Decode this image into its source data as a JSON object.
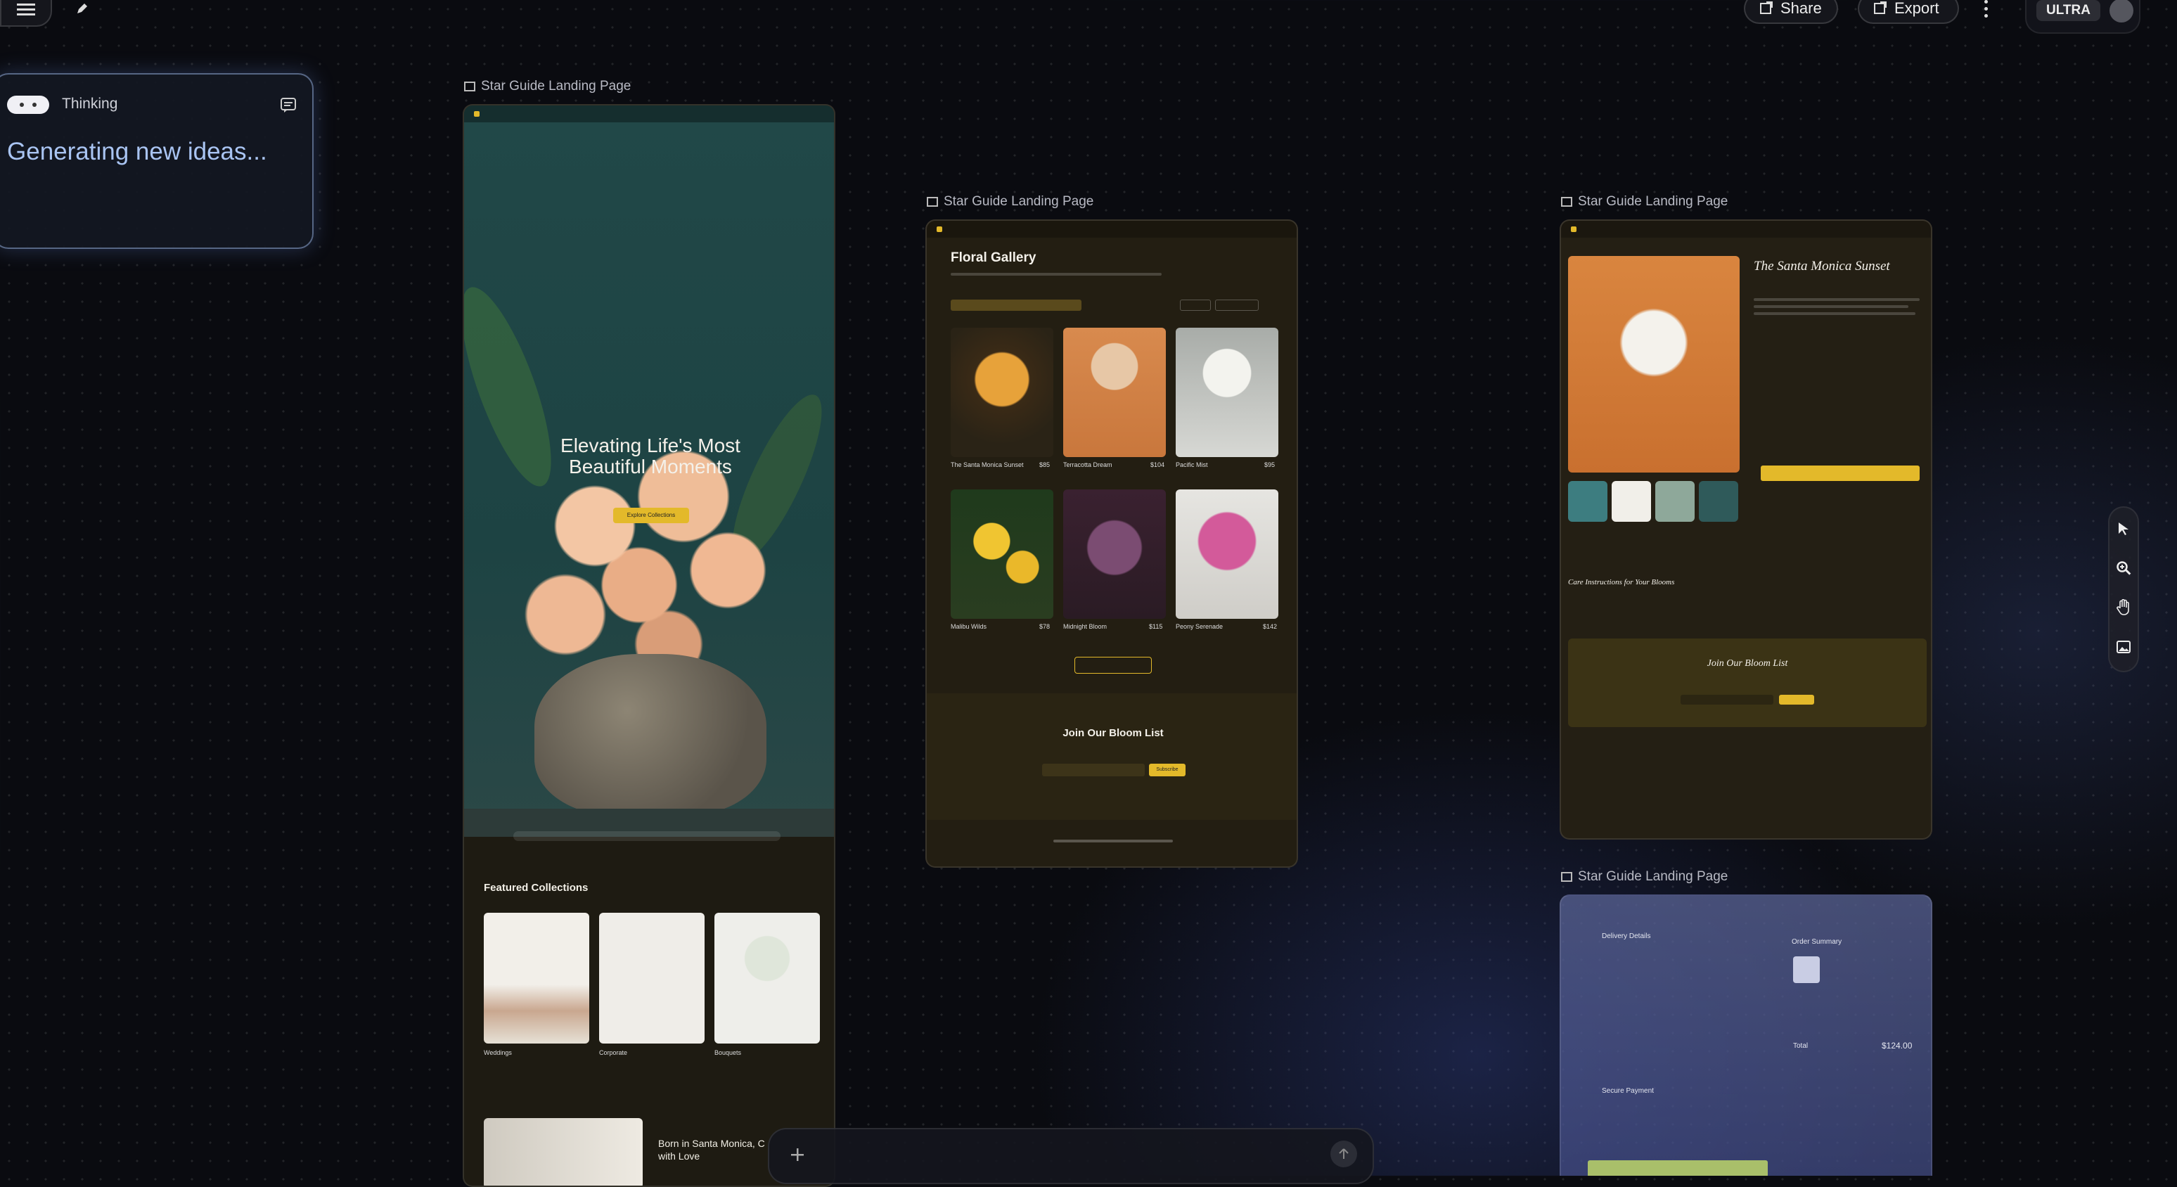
{
  "toolbar": {
    "share_label": "Share",
    "export_label": "Export",
    "plan_badge": "ULTRA"
  },
  "thinking": {
    "status": "Thinking",
    "message": "Generating new ideas..."
  },
  "frames": {
    "title": "Star Guide Landing Page"
  },
  "frame1": {
    "hero_title_line1": "Elevating Life's Most",
    "hero_title_line2": "Beautiful Moments",
    "cta": "Explore Collections",
    "section_title": "Featured Collections",
    "collections": [
      "Weddings",
      "Corporate",
      "Bouquets"
    ],
    "story_title_line1": "Born in Santa Monica, C",
    "story_title_line2": "with Love"
  },
  "frame2": {
    "gallery_title": "Floral Gallery",
    "products": [
      {
        "name": "The Santa Monica Sunset",
        "price": "$85"
      },
      {
        "name": "Terracotta Dream",
        "price": "$104"
      },
      {
        "name": "Pacific Mist",
        "price": "$95"
      },
      {
        "name": "Malibu Wilds",
        "price": "$78"
      },
      {
        "name": "Midnight Bloom",
        "price": "$115"
      },
      {
        "name": "Peony Serenade",
        "price": "$142"
      }
    ],
    "newsletter_title": "Join Our Bloom List",
    "subscribe": "Subscribe"
  },
  "frame3": {
    "product_title": "The Santa Monica Sunset",
    "care_title": "Care Instructions for Your Blooms",
    "newsletter_title": "Join Our Bloom List"
  },
  "frame4": {
    "delivery": "Delivery Details",
    "order_summary": "Order Summary",
    "total_label": "Total",
    "total_value": "$124.00",
    "secure_payment": "Secure Payment"
  },
  "colors": {
    "accent": "#e3b92a",
    "teal": "#1f4a4a",
    "dark_card": "#241f14"
  }
}
